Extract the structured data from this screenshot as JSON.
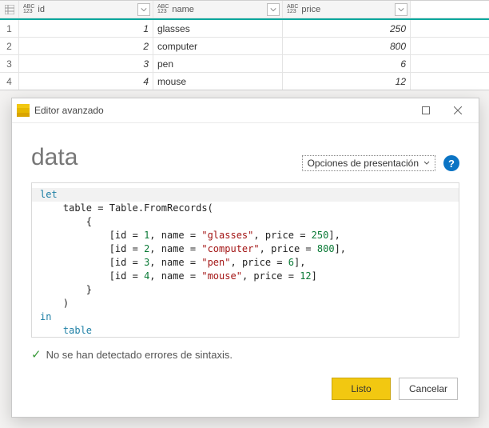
{
  "grid": {
    "columns": [
      "id",
      "name",
      "price"
    ],
    "rows": [
      {
        "n": "1",
        "id": "1",
        "name": "glasses",
        "price": "250"
      },
      {
        "n": "2",
        "id": "2",
        "name": "computer",
        "price": "800"
      },
      {
        "n": "3",
        "id": "3",
        "name": "pen",
        "price": "6"
      },
      {
        "n": "4",
        "id": "4",
        "name": "mouse",
        "price": "12"
      }
    ]
  },
  "dialog": {
    "title": "Editor avanzado",
    "query_name": "data",
    "options_label": "Opciones de presentación",
    "status": "No se han detectado errores de sintaxis.",
    "done": "Listo",
    "cancel": "Cancelar",
    "code": {
      "records": [
        {
          "id": "1",
          "name": "glasses",
          "price": "250"
        },
        {
          "id": "2",
          "name": "computer",
          "price": "800"
        },
        {
          "id": "3",
          "name": "pen",
          "price": "6"
        },
        {
          "id": "4",
          "name": "mouse",
          "price": "12"
        }
      ],
      "kw_let": "let",
      "kw_in": "in",
      "var": "table",
      "fn": "Table.FromRecords",
      "f_id": "id",
      "f_name": "name",
      "f_price": "price"
    }
  }
}
